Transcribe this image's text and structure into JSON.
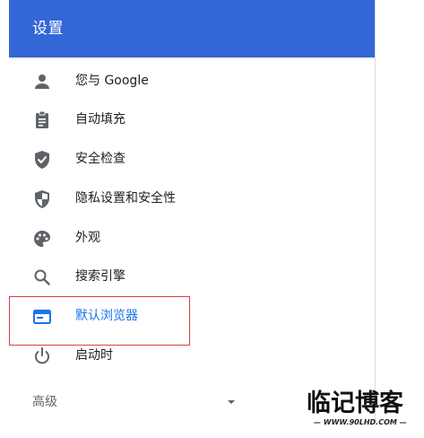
{
  "header": {
    "title": "设置"
  },
  "nav": {
    "items": [
      {
        "label": "您与 Google",
        "icon": "person-icon"
      },
      {
        "label": "自动填充",
        "icon": "clipboard-icon"
      },
      {
        "label": "安全检查",
        "icon": "shield-check-icon"
      },
      {
        "label": "隐私设置和安全性",
        "icon": "shield-privacy-icon"
      },
      {
        "label": "外观",
        "icon": "palette-icon"
      },
      {
        "label": "搜索引擎",
        "icon": "search-icon"
      },
      {
        "label": "默认浏览器",
        "icon": "browser-icon",
        "active": true
      },
      {
        "label": "启动时",
        "icon": "power-icon"
      }
    ],
    "advanced_label": "高级"
  },
  "watermark": {
    "title": "临记博客",
    "url": "WWW.90LHD.COM"
  },
  "colors": {
    "header_bg": "#3367d6",
    "icon": "#5f6368",
    "active": "#1a73e8",
    "highlight": "#d93e4c"
  }
}
